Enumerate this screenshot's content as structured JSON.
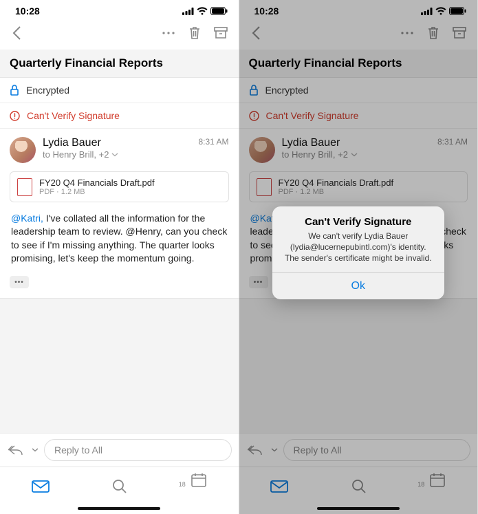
{
  "status": {
    "time": "10:28"
  },
  "subject": "Quarterly Financial Reports",
  "rows": {
    "encrypted": "Encrypted",
    "warn": "Can't Verify Signature"
  },
  "sender": {
    "name": "Lydia Bauer",
    "recipients": "to Henry Brill, +2",
    "time": "8:31 AM"
  },
  "attachment": {
    "name": "FY20 Q4 Financials Draft.pdf",
    "meta": "PDF · 1.2 MB"
  },
  "body": {
    "mention": "@Katri,",
    "text": " I've collated all the information for the leadership team to review. @Henry, can you check to see if I'm missing anything. The quarter looks promising, let's keep the momentum going."
  },
  "reply": {
    "placeholder": "Reply to All"
  },
  "calendar_day": "18",
  "alert": {
    "title": "Can't Verify Signature",
    "message": "We can't verify Lydia Bauer (lydia@lucernepubintl.com)'s identity. The sender's certificate might be invalid.",
    "ok": "Ok"
  }
}
